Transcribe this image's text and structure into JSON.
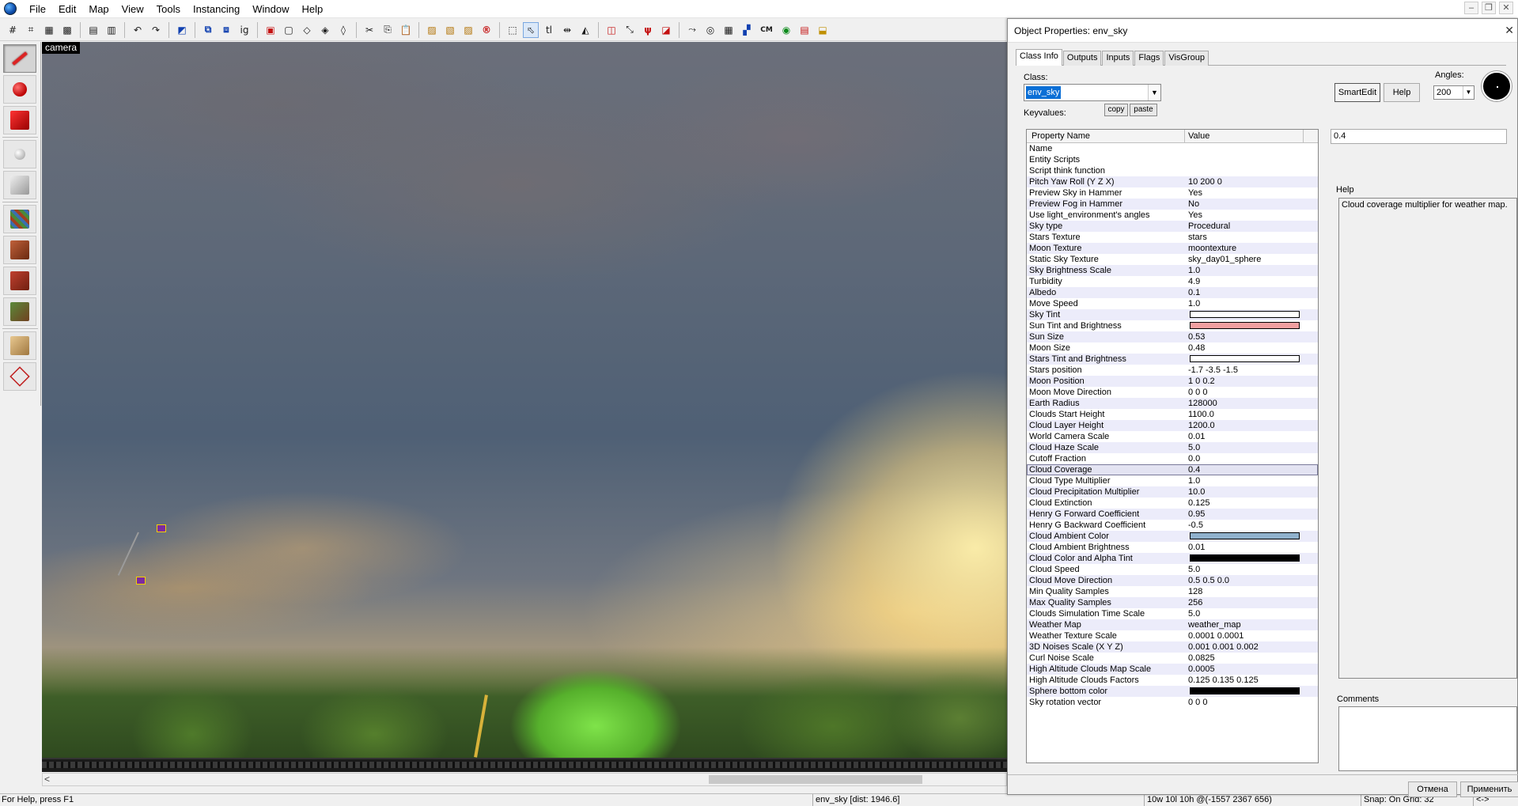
{
  "menu": [
    "File",
    "Edit",
    "Map",
    "View",
    "Tools",
    "Instancing",
    "Window",
    "Help"
  ],
  "toolbar": {
    "cm_label": "CM"
  },
  "viewport": {
    "label": "camera"
  },
  "status": {
    "help": "For Help, press F1",
    "selection": "env_sky    [dist: 1946.6]",
    "position": "10w 10l 10h @(-1557 2367 656)",
    "snap": "Snap: On Grid: 32",
    "zoom": "<->"
  },
  "dialog": {
    "title": "Object Properties: env_sky",
    "close": "✕",
    "tabs": [
      "Class Info",
      "Outputs",
      "Inputs",
      "Flags",
      "VisGroup"
    ],
    "class_label": "Class:",
    "class_value": "env_sky",
    "keyvalues_label": "Keyvalues:",
    "copy": "copy",
    "paste": "paste",
    "smartedit": "SmartEdit",
    "help": "Help",
    "angles_label": "Angles:",
    "angles_value": "200",
    "columns": {
      "name": "Property Name",
      "value": "Value"
    },
    "value_field": "0.4",
    "help_group": "Help",
    "help_text": "Cloud coverage multiplier for weather map.",
    "comments_label": "Comments",
    "cancel": "Отмена",
    "apply": "Применить"
  },
  "properties": [
    {
      "name": "Name",
      "value": ""
    },
    {
      "name": "Entity Scripts",
      "value": ""
    },
    {
      "name": "Script think function",
      "value": ""
    },
    {
      "name": "Pitch Yaw Roll (Y Z X)",
      "value": "10 200 0"
    },
    {
      "name": "Preview Sky in Hammer",
      "value": "Yes"
    },
    {
      "name": "Preview Fog in Hammer",
      "value": "No"
    },
    {
      "name": "Use light_environment's angles",
      "value": "Yes"
    },
    {
      "name": "Sky type",
      "value": "Procedural"
    },
    {
      "name": "Stars Texture",
      "value": "stars"
    },
    {
      "name": "Moon Texture",
      "value": "moontexture"
    },
    {
      "name": "Static Sky Texture",
      "value": "sky_day01_sphere"
    },
    {
      "name": "Sky Brightness Scale",
      "value": "1.0"
    },
    {
      "name": "Turbidity",
      "value": "4.9"
    },
    {
      "name": "Albedo",
      "value": "0.1"
    },
    {
      "name": "Move Speed",
      "value": "1.0"
    },
    {
      "name": "Sky Tint",
      "value": "",
      "color": "#ffffff"
    },
    {
      "name": "Sun Tint and Brightness",
      "value": "",
      "color": "#f2a0a0"
    },
    {
      "name": "Sun Size",
      "value": "0.53"
    },
    {
      "name": "Moon Size",
      "value": "0.48"
    },
    {
      "name": "Stars Tint and Brightness",
      "value": "",
      "color": "#ffffff"
    },
    {
      "name": "Stars position",
      "value": "-1.7 -3.5 -1.5"
    },
    {
      "name": "Moon Position",
      "value": "1 0 0.2"
    },
    {
      "name": "Moon Move Direction",
      "value": "0 0 0"
    },
    {
      "name": "Earth Radius",
      "value": "128000"
    },
    {
      "name": "Clouds Start Height",
      "value": "1100.0"
    },
    {
      "name": "Cloud Layer Height",
      "value": "1200.0"
    },
    {
      "name": "World Camera Scale",
      "value": "0.01"
    },
    {
      "name": "Cloud Haze Scale",
      "value": "5.0"
    },
    {
      "name": "Cutoff Fraction",
      "value": "0.0"
    },
    {
      "name": "Cloud Coverage",
      "value": "0.4",
      "selected": true
    },
    {
      "name": "Cloud Type Multiplier",
      "value": "1.0"
    },
    {
      "name": "Cloud Precipitation Multiplier",
      "value": "10.0"
    },
    {
      "name": "Cloud Extinction",
      "value": "0.125"
    },
    {
      "name": "Henry G Forward Coefficient",
      "value": "0.95"
    },
    {
      "name": "Henry G Backward Coefficient",
      "value": "-0.5"
    },
    {
      "name": "Cloud Ambient Color",
      "value": "",
      "color": "#8fb0cc"
    },
    {
      "name": "Cloud Ambient Brightness",
      "value": "0.01"
    },
    {
      "name": "Cloud Color and Alpha Tint",
      "value": "",
      "color": "#000000"
    },
    {
      "name": "Cloud Speed",
      "value": "5.0"
    },
    {
      "name": "Cloud Move Direction",
      "value": "0.5 0.5 0.0"
    },
    {
      "name": "Min Quality Samples",
      "value": "128"
    },
    {
      "name": "Max Quality Samples",
      "value": "256"
    },
    {
      "name": "Clouds Simulation Time Scale",
      "value": "5.0"
    },
    {
      "name": "Weather Map",
      "value": "weather_map"
    },
    {
      "name": "Weather Texture Scale",
      "value": "0.0001 0.0001"
    },
    {
      "name": "3D Noises Scale (X Y Z)",
      "value": "0.001 0.001 0.002"
    },
    {
      "name": "Curl Noise Scale",
      "value": "0.0825"
    },
    {
      "name": "High Altitude Clouds Map Scale",
      "value": "0.0005"
    },
    {
      "name": "High Altitude Clouds Factors",
      "value": "0.125 0.135 0.125"
    },
    {
      "name": "Sphere bottom color",
      "value": "",
      "color": "#000000"
    },
    {
      "name": "Sky rotation vector",
      "value": "0 0 0"
    }
  ]
}
